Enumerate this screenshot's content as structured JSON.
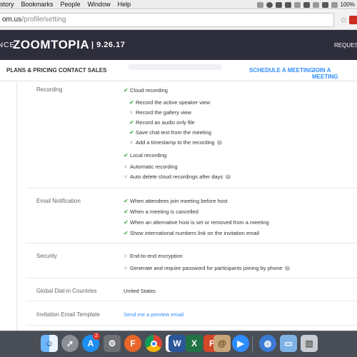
{
  "menubar": {
    "items": [
      "listory",
      "Bookmarks",
      "People",
      "Window",
      "Help"
    ],
    "battery": "100%"
  },
  "browser": {
    "url_host": "om.us",
    "url_path": "/profile/setting"
  },
  "banner": {
    "prefix": "NCE",
    "brand": "ZOOMTOPIA",
    "date": "| 9.26.17",
    "request": "REQUEST A"
  },
  "nav": {
    "plans": "PLANS & PRICING",
    "contact": "CONTACT SALES",
    "schedule": "SCHEDULE A MEETING",
    "join": "JOIN A MEETING"
  },
  "recording": {
    "label": "Recording",
    "cloud": "Cloud recording",
    "cloud_options": [
      {
        "label": "Record the active speaker view",
        "checked": true,
        "help": false
      },
      {
        "label": "Record the gallery view",
        "checked": false,
        "help": false
      },
      {
        "label": "Record an audio only file",
        "checked": true,
        "help": false
      },
      {
        "label": "Save chat text from the meeting",
        "checked": true,
        "help": false
      },
      {
        "label": "Add a timestamp to the recording",
        "checked": false,
        "help": true
      }
    ],
    "local": "Local recording",
    "automatic": "Automatic recording",
    "auto_delete": "Auto delete cloud recordings after days"
  },
  "email_notification": {
    "label": "Email Notification",
    "options": [
      "When attendees join meeting before host",
      "When a meeting is cancelled",
      "When an alternative host is set or removed from a meeting",
      "Show international numbers link on the invitation email"
    ]
  },
  "security": {
    "label": "Security",
    "options": [
      "End-to-end encryption",
      "Generate and require password for participants joining by phone"
    ]
  },
  "dialin": {
    "label": "Global Dial-in Countries",
    "value": "United States"
  },
  "invitation": {
    "label": "Invitation Email Template",
    "link": "Send me a preview email"
  },
  "dock": {
    "appstore_badge": "2",
    "apps": [
      "Finder",
      "Launchpad",
      "App Store",
      "System Preferences",
      "Firefox",
      "Chrome",
      "Calendar",
      "Word",
      "Excel",
      "PowerPoint",
      "Contacts",
      "Zoom",
      "Globe",
      "Folder",
      "Trash"
    ]
  }
}
